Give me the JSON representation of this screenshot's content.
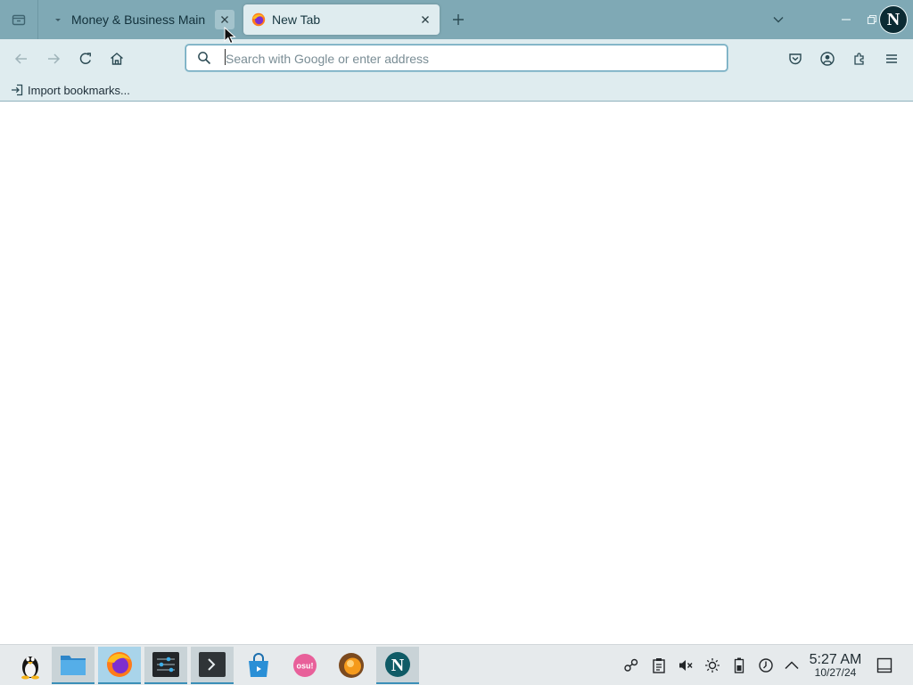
{
  "browser": {
    "tabs": [
      {
        "label": "Money & Business Main",
        "active": false,
        "favicon": "collapse-arrow-icon"
      },
      {
        "label": "New Tab",
        "active": true,
        "favicon": "firefox-icon"
      }
    ],
    "url_placeholder": "Search with Google or enter address",
    "url_value": "",
    "bookmarks": [
      {
        "label": "Import bookmarks...",
        "icon": "import-icon"
      }
    ],
    "toolbar_icons": [
      "back-icon",
      "forward-icon",
      "reload-icon",
      "home-icon",
      "pocket-icon",
      "account-icon",
      "extensions-icon",
      "menu-icon"
    ]
  },
  "taskbar": {
    "apps": [
      "tux-icon",
      "file-manager-icon",
      "firefox-icon",
      "settings-mixer-icon",
      "terminal-icon",
      "store-icon",
      "osu-icon",
      "orange-app-icon",
      "netscape-icon"
    ],
    "osu_label": "osu!",
    "tray_icons": [
      "network-icon",
      "clipboard-icon",
      "volume-muted-icon",
      "brightness-icon",
      "battery-icon",
      "update-icon",
      "tray-expand-icon"
    ],
    "clock": {
      "time": "5:27 AM",
      "date": "10/27/24"
    }
  },
  "window": {
    "avatar_letter": "N"
  },
  "colors": {
    "tabstrip": "#7fa9b5",
    "toolbar": "#dfecef",
    "accent": "#3a8fb7",
    "taskbar": "#e6eaec"
  }
}
